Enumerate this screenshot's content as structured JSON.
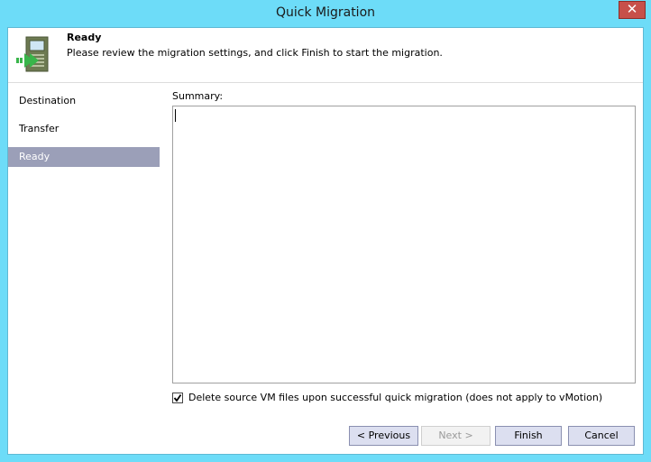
{
  "window": {
    "title": "Quick Migration",
    "close_glyph": "✕"
  },
  "header": {
    "title": "Ready",
    "description": "Please review the migration settings, and click Finish to start the migration.",
    "icon": "migration-wizard-icon"
  },
  "nav": {
    "items": [
      {
        "label": "Destination",
        "selected": false
      },
      {
        "label": "Transfer",
        "selected": false
      },
      {
        "label": "Ready",
        "selected": true
      }
    ]
  },
  "summary": {
    "label": "Summary:",
    "value": ""
  },
  "options": {
    "delete_source": {
      "label": "Delete source VM files upon successful quick migration (does not apply to vMotion)",
      "checked": true
    }
  },
  "buttons": {
    "previous": "< Previous",
    "next": "Next >",
    "finish": "Finish",
    "cancel": "Cancel"
  },
  "colors": {
    "titlebar": "#6ddcf8",
    "selected_nav": "#9b9fb8",
    "close": "#c7504a"
  }
}
